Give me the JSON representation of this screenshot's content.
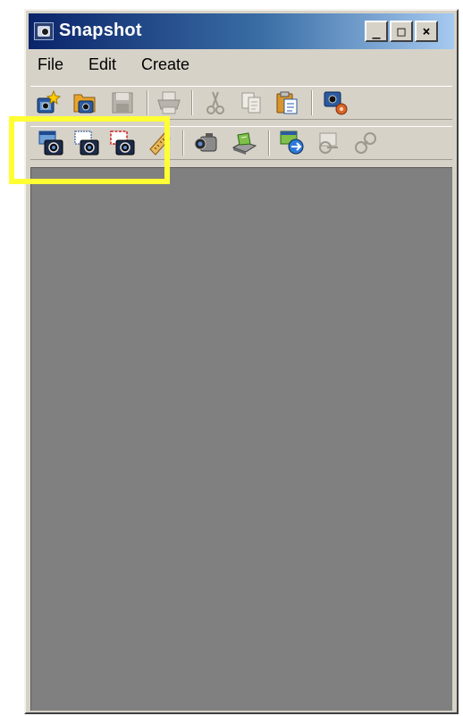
{
  "window": {
    "title": "Snapshot",
    "app_icon": "camera-app-icon",
    "controls": {
      "minimize": "_",
      "maximize": "□",
      "close": "×"
    }
  },
  "menu": [
    {
      "label": "File"
    },
    {
      "label": "Edit"
    },
    {
      "label": "Create"
    }
  ],
  "toolbar1": [
    {
      "name": "new-icon",
      "enabled": true
    },
    {
      "name": "open-icon",
      "enabled": true
    },
    {
      "name": "save-icon",
      "enabled": false
    },
    {
      "name": "print-icon",
      "enabled": false
    },
    {
      "name": "cut-icon",
      "enabled": false
    },
    {
      "name": "copy-icon",
      "enabled": false
    },
    {
      "name": "paste-icon",
      "enabled": true
    },
    {
      "name": "capture-settings-icon",
      "enabled": true
    }
  ],
  "toolbar2": [
    {
      "name": "capture-window-icon",
      "enabled": true
    },
    {
      "name": "capture-region-icon",
      "enabled": true
    },
    {
      "name": "capture-object-icon",
      "enabled": true
    },
    {
      "name": "ruler-icon",
      "enabled": true
    },
    {
      "name": "camcorder-icon",
      "enabled": true
    },
    {
      "name": "scanner-icon",
      "enabled": true
    },
    {
      "name": "export-icon",
      "enabled": true
    },
    {
      "name": "link-icon",
      "enabled": false
    },
    {
      "name": "unlink-icon",
      "enabled": false
    }
  ],
  "highlight_color": "#ffff33",
  "client_background": "#808080"
}
